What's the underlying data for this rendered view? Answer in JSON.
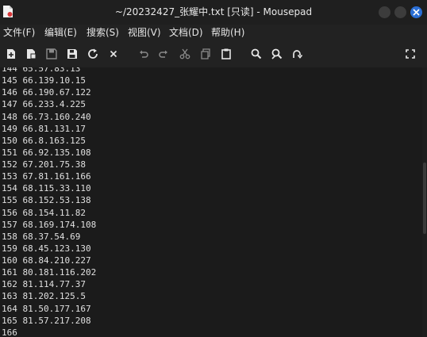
{
  "window": {
    "title": "~/20232427_张耀中.txt [只读] - Mousepad"
  },
  "menu": [
    {
      "label": "文件(F)"
    },
    {
      "label": "编辑(E)"
    },
    {
      "label": "搜索(S)"
    },
    {
      "label": "视图(V)"
    },
    {
      "label": "文档(D)"
    },
    {
      "label": "帮助(H)"
    }
  ],
  "toolbar_icons": [
    "new-document-icon",
    "new-window-icon",
    "save-icon",
    "save-as-icon",
    "reload-icon",
    "close-icon",
    "undo-icon",
    "redo-icon",
    "cut-icon",
    "copy-icon",
    "paste-icon",
    "find-icon",
    "find-replace-icon",
    "goto-icon",
    "fullscreen-icon"
  ],
  "editor": {
    "lines": [
      "144 65.57.83.13",
      "145 66.139.10.15",
      "146 66.190.67.122",
      "147 66.233.4.225",
      "148 66.73.160.240",
      "149 66.81.131.17",
      "150 66.8.163.125",
      "151 66.92.135.108",
      "152 67.201.75.38",
      "153 67.81.161.166",
      "154 68.115.33.110",
      "155 68.152.53.138",
      "156 68.154.11.82",
      "157 68.169.174.108",
      "158 68.37.54.69",
      "159 68.45.123.130",
      "160 68.84.210.227",
      "161 80.181.116.202",
      "162 81.114.77.37",
      "163 81.202.125.5",
      "164 81.50.177.167",
      "165 81.57.217.208",
      "166"
    ]
  },
  "colors": {
    "background": "#222222",
    "editor_bg": "#1b1b1b",
    "close_button": "#2b6fd6"
  }
}
